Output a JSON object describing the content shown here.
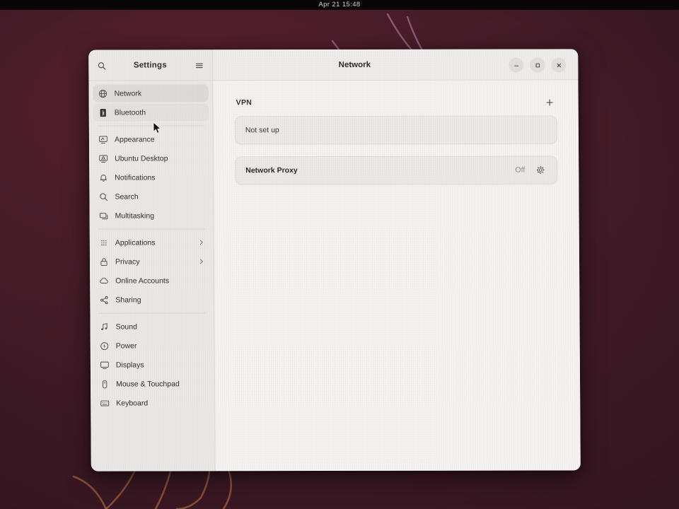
{
  "topbar": {
    "clock": "Apr 21  15:48"
  },
  "window": {
    "title": "Network",
    "controls": {
      "minimize": "minimize-button",
      "maximize": "maximize-button",
      "close": "close-button"
    }
  },
  "sidebar": {
    "title": "Settings",
    "search_icon": "search-icon",
    "menu_icon": "hamburger-menu-icon",
    "groups": [
      {
        "items": [
          {
            "label": "Network",
            "icon": "network-icon",
            "state": "selected"
          },
          {
            "label": "Bluetooth",
            "icon": "bluetooth-icon",
            "state": "hovered"
          }
        ]
      },
      {
        "items": [
          {
            "label": "Appearance",
            "icon": "appearance-icon",
            "state": "normal"
          },
          {
            "label": "Ubuntu Desktop",
            "icon": "ubuntu-desktop-icon",
            "state": "normal"
          },
          {
            "label": "Notifications",
            "icon": "notifications-icon",
            "state": "normal"
          },
          {
            "label": "Search",
            "icon": "search-icon",
            "state": "normal"
          },
          {
            "label": "Multitasking",
            "icon": "multitasking-icon",
            "state": "normal"
          }
        ]
      },
      {
        "items": [
          {
            "label": "Applications",
            "icon": "applications-icon",
            "state": "normal",
            "chevron": true
          },
          {
            "label": "Privacy",
            "icon": "privacy-lock-icon",
            "state": "normal",
            "chevron": true
          },
          {
            "label": "Online Accounts",
            "icon": "online-accounts-icon",
            "state": "normal"
          },
          {
            "label": "Sharing",
            "icon": "sharing-icon",
            "state": "normal"
          }
        ]
      },
      {
        "items": [
          {
            "label": "Sound",
            "icon": "sound-icon",
            "state": "normal"
          },
          {
            "label": "Power",
            "icon": "power-icon",
            "state": "normal"
          },
          {
            "label": "Displays",
            "icon": "displays-icon",
            "state": "normal"
          },
          {
            "label": "Mouse & Touchpad",
            "icon": "mouse-icon",
            "state": "normal"
          },
          {
            "label": "Keyboard",
            "icon": "keyboard-icon",
            "state": "normal"
          }
        ]
      }
    ]
  },
  "content": {
    "vpn": {
      "section_title": "VPN",
      "add_button_icon": "plus-icon",
      "status": "Not set up"
    },
    "proxy": {
      "label": "Network Proxy",
      "value": "Off",
      "settings_icon": "gear-icon"
    }
  },
  "colors": {
    "wallpaper_base": "#4b1c29",
    "wallpaper_accent_warm": "#c87b4a",
    "wallpaper_accent_pink": "#c98bb4",
    "window_bg": "#f5f3f2",
    "sidebar_bg": "#ebe9e8",
    "selected_row": "#dedbd9",
    "text_primary": "#2c2826",
    "text_muted": "#918b87"
  }
}
